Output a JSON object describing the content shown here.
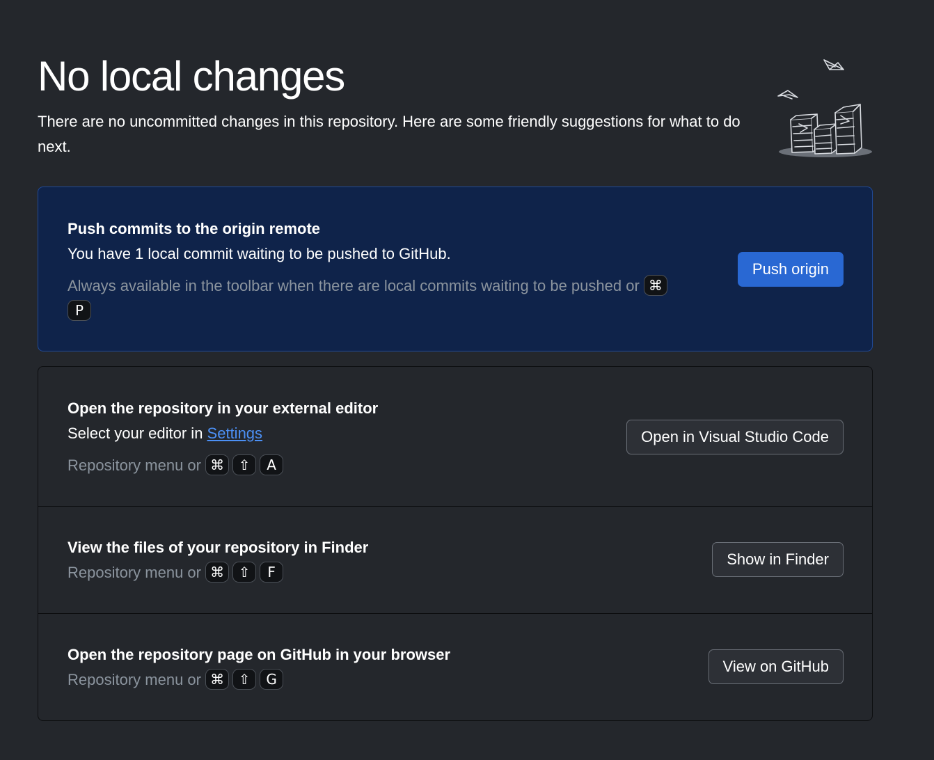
{
  "header": {
    "title": "No local changes",
    "subtitle": "There are no uncommitted changes in this repository. Here are some friendly suggestions for what to do next."
  },
  "push_card": {
    "heading": "Push commits to the origin remote",
    "description": "You have 1 local commit waiting to be pushed to GitHub.",
    "hint": "Always available in the toolbar when there are local commits waiting to be pushed or",
    "keys": [
      "⌘",
      "P"
    ],
    "button_label": "Push origin"
  },
  "editor_row": {
    "heading": "Open the repository in your external editor",
    "description_prefix": "Select your editor in ",
    "settings_link": "Settings",
    "hint": "Repository menu or",
    "keys": [
      "⌘",
      "⇧",
      "A"
    ],
    "button_label": "Open in Visual Studio Code"
  },
  "finder_row": {
    "heading": "View the files of your repository in Finder",
    "hint": "Repository menu or",
    "keys": [
      "⌘",
      "⇧",
      "F"
    ],
    "button_label": "Show in Finder"
  },
  "github_row": {
    "heading": "Open the repository page on GitHub in your browser",
    "hint": "Repository menu or",
    "keys": [
      "⌘",
      "⇧",
      "G"
    ],
    "button_label": "View on GitHub"
  },
  "colors": {
    "background": "#24272c",
    "push_card_bg": "#0f234a",
    "primary_button": "#2968d3",
    "link": "#4c90f5",
    "hint_text": "#8b949e"
  },
  "icons": {
    "illustration": "paper-stacks-illustration"
  }
}
